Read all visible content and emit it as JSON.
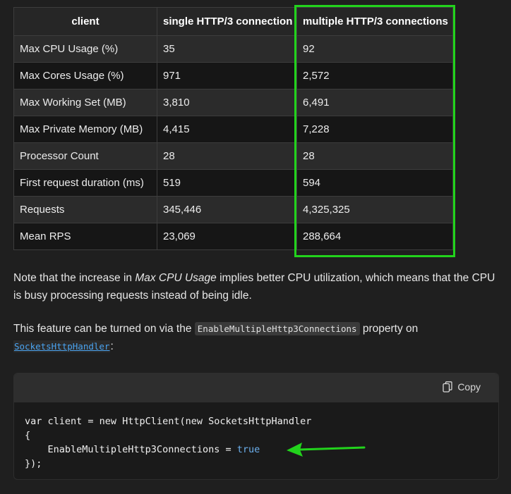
{
  "table": {
    "headers": [
      "client",
      "single HTTP/3 connection",
      "multiple HTTP/3 connections"
    ],
    "rows": [
      [
        "Max CPU Usage (%)",
        "35",
        "92"
      ],
      [
        "Max Cores Usage (%)",
        "971",
        "2,572"
      ],
      [
        "Max Working Set (MB)",
        "3,810",
        "6,491"
      ],
      [
        "Max Private Memory (MB)",
        "4,415",
        "7,228"
      ],
      [
        "Processor Count",
        "28",
        "28"
      ],
      [
        "First request duration (ms)",
        "519",
        "594"
      ],
      [
        "Requests",
        "345,446",
        "4,325,325"
      ],
      [
        "Mean RPS",
        "23,069",
        "288,664"
      ]
    ]
  },
  "note": {
    "before": "Note that the increase in ",
    "emphasis": "Max CPU Usage",
    "after": " implies better CPU utilization, which means that the CPU is busy processing requests instead of being idle."
  },
  "feature": {
    "before": "This feature can be turned on via the ",
    "property": "EnableMultipleHttp3Connections",
    "middle": " property on ",
    "link": "SocketsHttpHandler",
    "after": ":"
  },
  "code": {
    "copy_label": "Copy",
    "line1": "var client = new HttpClient(new SocketsHttpHandler",
    "line2": "{",
    "line3_prefix": "    EnableMultipleHttp3Connections = ",
    "line3_value": "true",
    "line4": "});"
  },
  "colors": {
    "highlight": "#22d31c",
    "background": "#1f1f1f",
    "link": "#4aa3f0",
    "keyword": "#6cb0ee"
  },
  "icons": [
    "copy-icon",
    "arrow-annotation"
  ]
}
